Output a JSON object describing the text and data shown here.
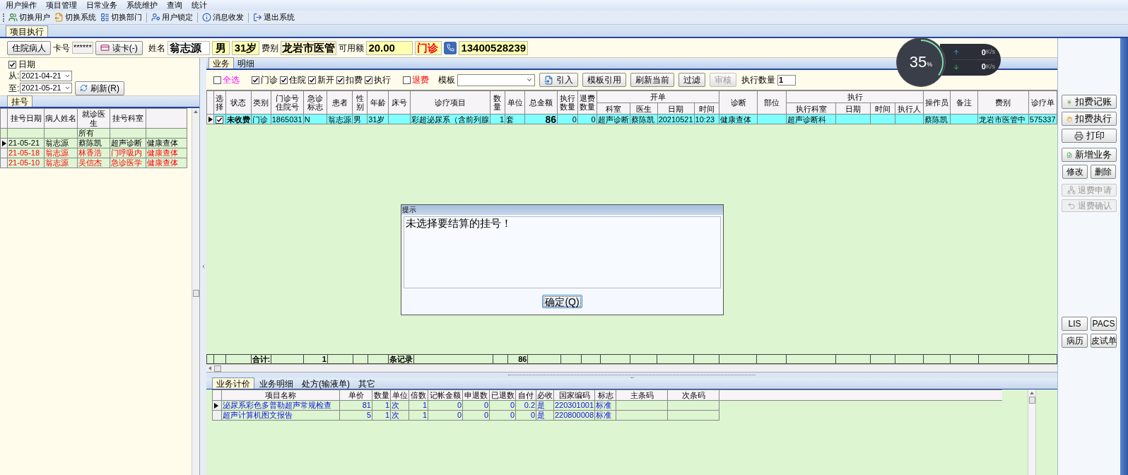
{
  "menu": [
    "用户操作",
    "项目管理",
    "日常业务",
    "系统维护",
    "查询",
    "统计"
  ],
  "toolbar": [
    "切换用户",
    "切换系统",
    "切换部门",
    "用户锁定",
    "消息收发",
    "退出系统"
  ],
  "document_tabs": [
    {
      "label": "项目执行",
      "selected": true
    }
  ],
  "patient": {
    "type_button": "住院病人",
    "card_label": "卡号",
    "card_value": "******",
    "read_card_button": "读卡(-)",
    "name_label": "姓名",
    "name": "翁志源",
    "sex": "男",
    "age": "31岁",
    "fee_type_label": "费别",
    "fee_type": "龙岩市医管",
    "balance_label": "可用额",
    "balance": "20.00",
    "visit_type": "门诊",
    "phone": "13400528239"
  },
  "left": {
    "date_filter": {
      "label": "日期",
      "checked": true
    },
    "from_label": "从:",
    "from": "2021-04-21",
    "to_label": "至:",
    "to": "2021-05-21",
    "refresh_button": "刷新(R)",
    "tabs": [
      {
        "label": "挂号",
        "selected": true
      }
    ],
    "columns": [
      "挂号日期",
      "病人姓名",
      "就诊医生",
      "挂号科室"
    ],
    "filter_value": "所有",
    "rows": [
      {
        "selected": true,
        "kind": "normal",
        "cells": [
          "21-05-21",
          "翁志源",
          "蔡陈凯",
          "超声诊断",
          "健康查体"
        ]
      },
      {
        "selected": false,
        "kind": "alert",
        "cells": [
          "21-05-18",
          "翁志源",
          "林香浩",
          "门呼吸内",
          "健康查体"
        ]
      },
      {
        "selected": false,
        "kind": "alert",
        "cells": [
          "21-05-10",
          "翁志源",
          "吴信杰",
          "急诊医学",
          "健康查体"
        ]
      }
    ]
  },
  "main": {
    "tabs": [
      {
        "label": "业务",
        "selected": true
      },
      {
        "label": "明细",
        "selected": false
      }
    ],
    "filters": [
      {
        "label": "全选",
        "checked": false,
        "kind": "select_all"
      },
      {
        "label": "门诊",
        "checked": true,
        "kind": "option"
      },
      {
        "label": "住院",
        "checked": true,
        "kind": "option"
      },
      {
        "label": "新开",
        "checked": true,
        "kind": "option"
      },
      {
        "label": "扣费",
        "checked": true,
        "kind": "option"
      },
      {
        "label": "执行",
        "checked": true,
        "kind": "option"
      },
      {
        "label": "退费",
        "checked": false,
        "kind": "refund"
      }
    ],
    "template_label": "模板",
    "buttons": [
      {
        "label": "引入",
        "disabled": false
      },
      {
        "label": "模板引用",
        "disabled": false
      },
      {
        "label": "刷新当前",
        "disabled": false
      },
      {
        "label": "过滤",
        "disabled": false
      },
      {
        "label": "审核",
        "disabled": true
      }
    ],
    "exec_count_label": "执行数量",
    "exec_count": "1",
    "columns": [
      {
        "label": "选择"
      },
      {
        "label": "状态"
      },
      {
        "label": "类别"
      },
      {
        "label": "门诊号住院号"
      },
      {
        "label": "急诊标志"
      },
      {
        "label": "患者"
      },
      {
        "label": "性别"
      },
      {
        "label": "年龄"
      },
      {
        "label": "床号"
      },
      {
        "label": "诊疗项目"
      },
      {
        "label": "数量"
      },
      {
        "label": "单位"
      },
      {
        "label": "总金额"
      },
      {
        "label": "执行数量"
      },
      {
        "label": "退费数量"
      },
      {
        "label": "开单",
        "colspan": 4,
        "children": [
          {
            "label": "科室"
          },
          {
            "label": "医生"
          },
          {
            "label": "日期"
          },
          {
            "label": "时间"
          }
        ]
      },
      {
        "label": "诊断"
      },
      {
        "label": "部位"
      },
      {
        "label": "执行",
        "colspan": 4,
        "children": [
          {
            "label": "执行科室"
          },
          {
            "label": "日期"
          },
          {
            "label": "时间"
          },
          {
            "label": "执行人"
          }
        ]
      },
      {
        "label": "操作员"
      },
      {
        "label": "备注"
      },
      {
        "label": "费别"
      },
      {
        "label": "诊疗单"
      }
    ],
    "rows": [
      {
        "selected": true,
        "checked": true,
        "cells": [
          "",
          "未收费",
          "门诊",
          "1865031",
          "N",
          "翁志源",
          "男",
          "31岁",
          "",
          "彩超泌尿系（含前列腺",
          "1",
          "套",
          "86",
          "0",
          "0",
          "超声诊断",
          "蔡陈凯",
          "20210521",
          "10:23",
          "健康查体",
          "",
          "超声诊断科",
          "",
          "",
          "",
          "蔡陈凯",
          "",
          "龙岩市医管中",
          "575337"
        ]
      }
    ],
    "totals": {
      "label": "合计:",
      "count": "1",
      "records_label": "条记录",
      "amount": "86"
    }
  },
  "details": {
    "tabs": [
      {
        "label": "业务计价",
        "selected": true
      },
      {
        "label": "业务明细",
        "selected": false
      },
      {
        "label": "处方(输液单)",
        "selected": false
      },
      {
        "label": "其它",
        "selected": false
      }
    ],
    "columns": [
      "项目名称",
      "单价",
      "数量",
      "单位",
      "倍数",
      "记帐金额",
      "申退数",
      "已退数",
      "自付",
      "必收",
      "国家编码",
      "标志",
      "主条码",
      "次条码"
    ],
    "rows": [
      {
        "selected": true,
        "cells": [
          "泌尿系彩色多普勒超声常规检查",
          "81",
          "1",
          "次",
          "1",
          "0",
          "0",
          "0",
          "0.2",
          "是",
          "220301001",
          "标准",
          "",
          ""
        ]
      },
      {
        "selected": false,
        "cells": [
          "超声计算机图文报告",
          "5",
          "1",
          "次",
          "1",
          "0",
          "0",
          "0",
          "0",
          "是",
          "220800008",
          "标准",
          "",
          ""
        ]
      }
    ]
  },
  "actions": [
    {
      "label": "扣费记账",
      "disabled": false
    },
    {
      "label": "扣费执行",
      "disabled": false
    },
    {
      "label": "打印",
      "disabled": false
    },
    {
      "label": "新增业务",
      "disabled": false
    }
  ],
  "edit_buttons": [
    {
      "label": "修改",
      "disabled": false
    },
    {
      "label": "删除",
      "disabled": false
    }
  ],
  "refund_actions": [
    {
      "label": "退费申请",
      "disabled": true
    },
    {
      "label": "退费确认",
      "disabled": true
    }
  ],
  "extra_buttons": [
    "LIS",
    "PACS",
    "病历",
    "皮试单"
  ],
  "dialog": {
    "title": "提示",
    "message": "未选择要结算的挂号！",
    "ok_button": "确定(Q)"
  },
  "network_widget": {
    "percent": "35",
    "percent_unit": "%",
    "upload": {
      "value": "0",
      "unit": "K/s"
    },
    "download": {
      "value": "0",
      "unit": "K/s"
    }
  }
}
